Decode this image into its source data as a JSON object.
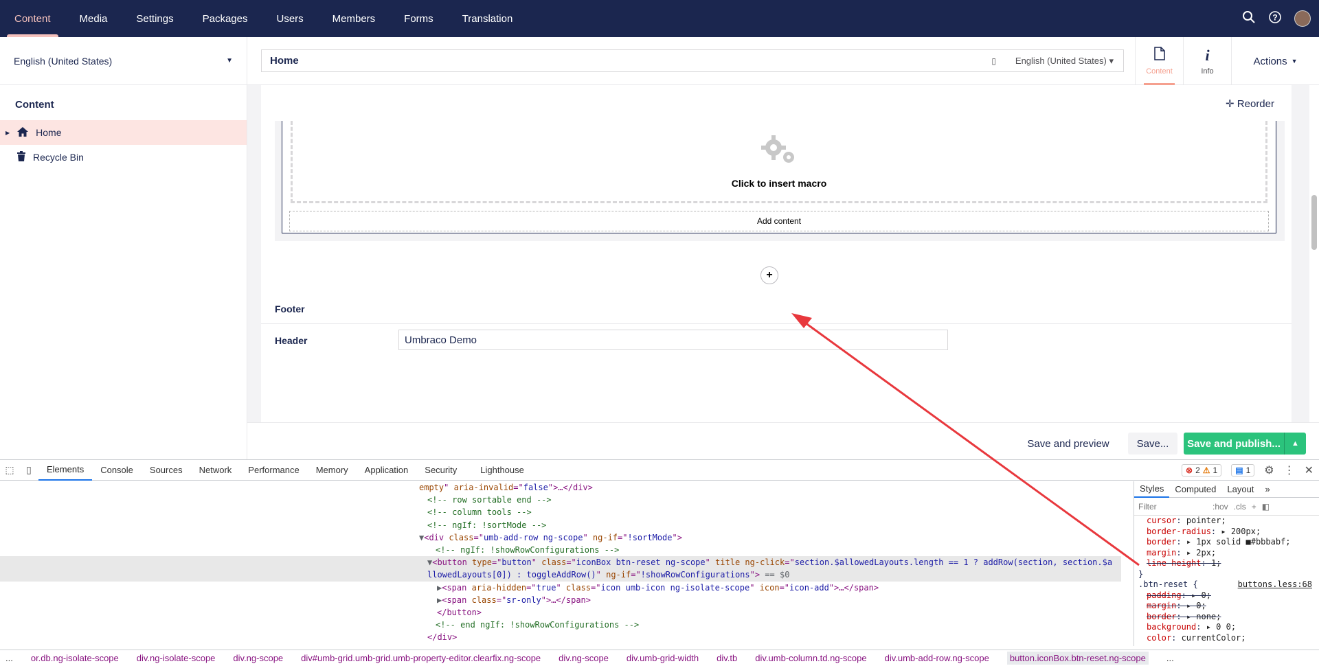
{
  "topnav": {
    "items": [
      "Content",
      "Media",
      "Settings",
      "Packages",
      "Users",
      "Members",
      "Forms",
      "Translation"
    ],
    "active": "Content",
    "tools": {
      "search_icon": "search-icon",
      "help_icon": "help-icon",
      "avatar": "avatar"
    }
  },
  "sidebar": {
    "language": "English (United States)",
    "tree_title": "Content",
    "items": [
      {
        "label": "Home",
        "icon": "home-icon"
      },
      {
        "label": "Recycle Bin",
        "icon": "trash-icon"
      }
    ]
  },
  "editor": {
    "name": "Home",
    "language": "English (United States)",
    "tabs": [
      {
        "label": "Content",
        "icon": "document-icon"
      },
      {
        "label": "Info",
        "icon": "info-icon"
      }
    ],
    "actions_label": "Actions",
    "reorder_label": "Reorder",
    "macro_label": "Click to insert macro",
    "add_content_label": "Add content",
    "add_row_symbol": "+",
    "footer_group": "Footer",
    "header_label": "Header",
    "header_value": "Umbraco Demo"
  },
  "footerbar": {
    "preview": "Save and preview",
    "save": "Save...",
    "publish": "Save and publish..."
  },
  "devtools": {
    "tabs": [
      "Elements",
      "Console",
      "Sources",
      "Network",
      "Performance",
      "Memory",
      "Application",
      "Security",
      "Lighthouse"
    ],
    "active": "Elements",
    "errors": "2",
    "warnings": "1",
    "info": "1",
    "styles_tabs": [
      "Styles",
      "Computed",
      "Layout"
    ],
    "filter_placeholder": "Filter",
    "hov": ":hov",
    "cls": ".cls",
    "rule_selector": ".btn-reset {",
    "rule_source": "buttons.less:68",
    "breadcrumbs": [
      "...",
      "or.db.ng-isolate-scope",
      "div.ng-isolate-scope",
      "div.ng-scope",
      "div#umb-grid.umb-grid.umb-property-editor.clearfix.ng-scope",
      "div.ng-scope",
      "div.umb-grid-width",
      "div.tb",
      "div.umb-column.td.ng-scope",
      "div.umb-add-row.ng-scope",
      "button.iconBox.btn-reset.ng-scope",
      "..."
    ]
  }
}
